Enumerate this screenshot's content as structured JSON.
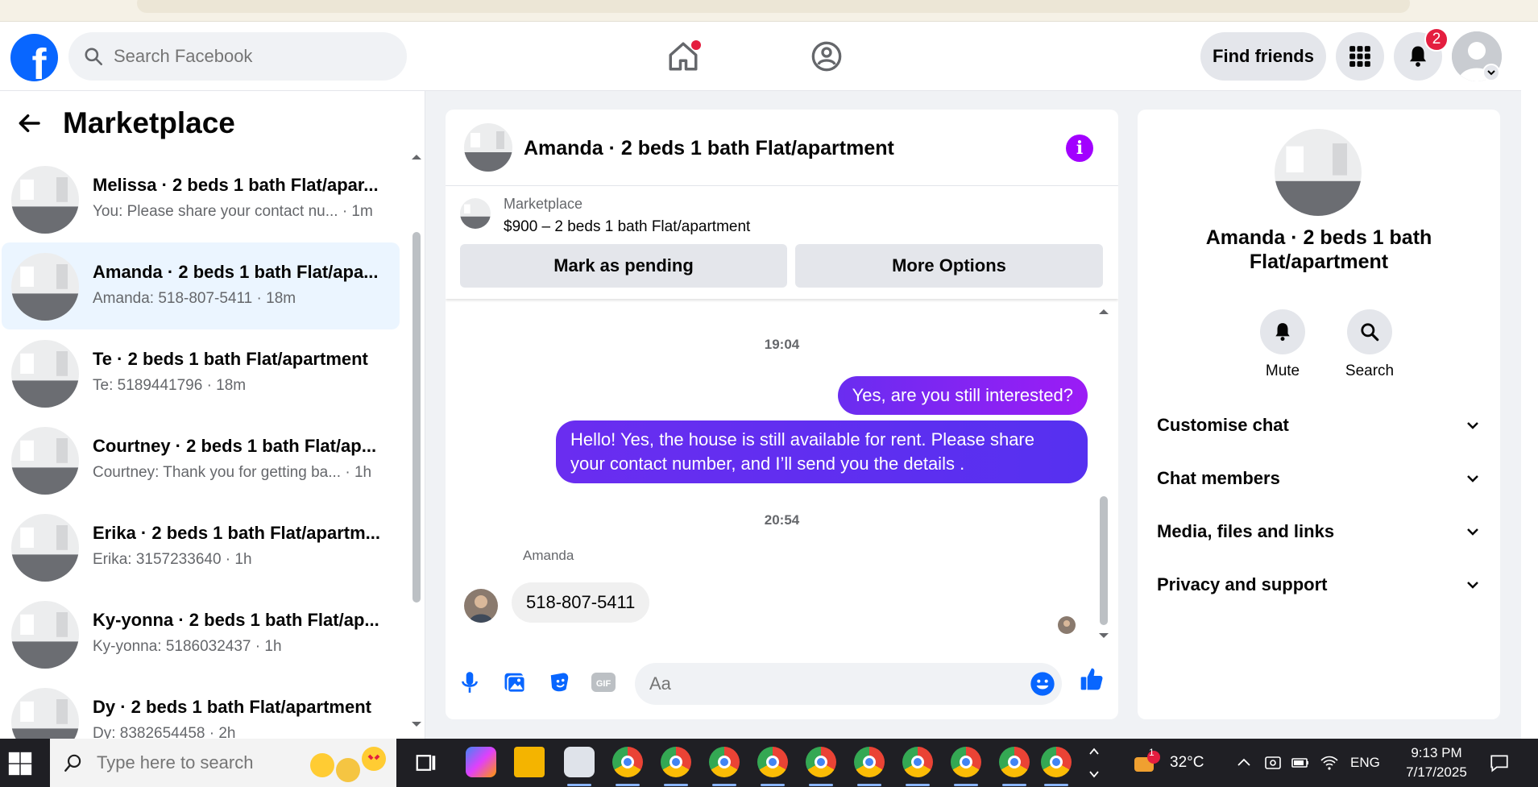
{
  "topbar": {
    "search_placeholder": "Search Facebook",
    "find_friends_label": "Find friends",
    "notifications_count": "2",
    "brand_color": "#0866ff"
  },
  "left": {
    "title": "Marketplace",
    "conversations": [
      {
        "name": "Melissa · 2 beds 1 bath Flat/apar...",
        "preview": "You: Please share your contact nu...  · 1m",
        "active": false
      },
      {
        "name": "Amanda · 2 beds 1 bath Flat/apa...",
        "preview": "Amanda: 518-807-5411 · 18m",
        "active": true
      },
      {
        "name": "Te · 2 beds 1 bath Flat/apartment",
        "preview": "Te: 5189441796 · 18m",
        "active": false
      },
      {
        "name": "Courtney · 2 beds 1 bath Flat/ap...",
        "preview": "Courtney: Thank you for getting ba... · 1h",
        "active": false
      },
      {
        "name": "Erika · 2 beds 1 bath Flat/apartm...",
        "preview": "Erika: 3157233640 · 1h",
        "active": false
      },
      {
        "name": "Ky-yonna · 2 beds 1 bath Flat/ap...",
        "preview": "Ky-yonna: 5186032437 · 1h",
        "active": false
      },
      {
        "name": "Dy · 2 beds 1 bath Flat/apartment",
        "preview": "Dy: 8382654458 · 2h",
        "active": false
      }
    ]
  },
  "chat": {
    "title": "Amanda · 2 beds 1 bath Flat/apartment",
    "marketplace_label": "Marketplace",
    "listing": "$900 – 2 beds 1 bath Flat/apartment",
    "mark_pending_label": "Mark as pending",
    "more_options_label": "More Options",
    "timestamp_1": "19:04",
    "out_msg_1": "Yes, are you still interested?",
    "out_msg_2": "Hello! Yes, the house is still available for rent. Please share your contact number, and I’ll send you the details .",
    "timestamp_2": "20:54",
    "sender_name": "Amanda",
    "in_msg_1": "518-807-5411",
    "composer_placeholder": "Aa",
    "accent_color": "#a200ff"
  },
  "info": {
    "name": "Amanda · 2 beds 1 bath Flat/apartment",
    "mute_label": "Mute",
    "search_label": "Search",
    "sections": [
      "Customise chat",
      "Chat members",
      "Media, files and links",
      "Privacy and support"
    ]
  },
  "taskbar": {
    "search_placeholder": "Type here to search",
    "temperature": "32°C",
    "language": "ENG",
    "time": "9:13 PM",
    "date": "7/17/2025",
    "weather_badge": "1"
  }
}
